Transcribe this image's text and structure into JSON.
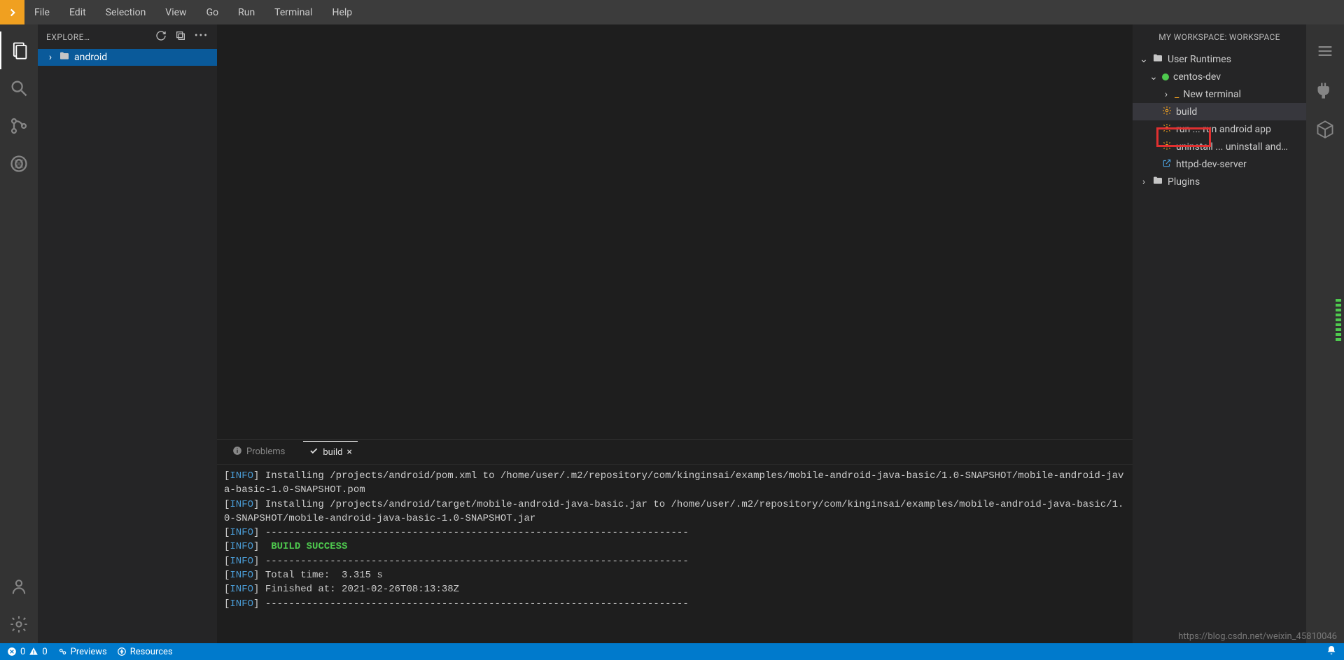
{
  "menu": {
    "items": [
      "File",
      "Edit",
      "Selection",
      "View",
      "Go",
      "Run",
      "Terminal",
      "Help"
    ]
  },
  "explorer": {
    "title": "EXPLORE…",
    "root": "android"
  },
  "panel": {
    "problems_tab": "Problems",
    "build_tab": "build",
    "lines": [
      {
        "prefix": "[INFO]",
        "text": " Installing /projects/android/pom.xml to /home/user/.m2/repository/com/kinginsai/examples/mobile-android-java-basic/1.0-SNAPSHOT/mobile-android-java-basic-1.0-SNAPSHOT.pom"
      },
      {
        "prefix": "[INFO]",
        "text": " Installing /projects/android/target/mobile-android-java-basic.jar to /home/user/.m2/repository/com/kinginsai/examples/mobile-android-java-basic/1.0-SNAPSHOT/mobile-android-java-basic-1.0-SNAPSHOT.jar"
      },
      {
        "prefix": "[INFO]",
        "text": " ------------------------------------------------------------------------"
      },
      {
        "prefix": "[INFO]",
        "text": " ",
        "success": "BUILD SUCCESS"
      },
      {
        "prefix": "[INFO]",
        "text": " ------------------------------------------------------------------------"
      },
      {
        "prefix": "[INFO]",
        "text": " Total time:  3.315 s"
      },
      {
        "prefix": "[INFO]",
        "text": " Finished at: 2021-02-26T08:13:38Z"
      },
      {
        "prefix": "[INFO]",
        "text": " ------------------------------------------------------------------------"
      }
    ]
  },
  "workspace": {
    "title": "MY WORKSPACE: WORKSPACE",
    "user_runtimes": "User Runtimes",
    "centos_dev": "centos-dev",
    "new_terminal": "New terminal",
    "build": "build",
    "run": "run ... run android app",
    "uninstall": "uninstall ... uninstall and…",
    "httpd": "httpd-dev-server",
    "plugins": "Plugins"
  },
  "statusbar": {
    "errors": "0",
    "warnings": "0",
    "previews": "Previews",
    "resources": "Resources"
  },
  "watermark": "https://blog.csdn.net/weixin_45810046"
}
